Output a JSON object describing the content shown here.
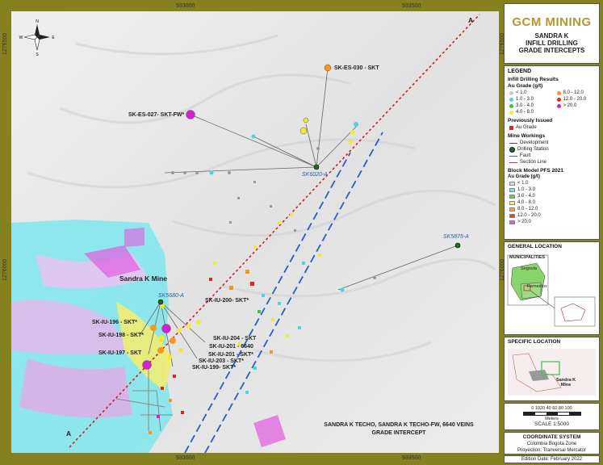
{
  "map": {
    "coords_top": [
      "933000",
      "933500"
    ],
    "coords_bottom": [
      "933000",
      "933500"
    ],
    "coords_left": [
      "1276500",
      "1276000"
    ],
    "coords_right": [
      "1276500",
      "1276000"
    ],
    "section_letters": [
      "A",
      "A"
    ],
    "station_labels": [
      "SK6020-A",
      "SK5875-A",
      "SK5680-A"
    ],
    "mine_label": "Sandra K Mine",
    "drill_labels": [
      "SK-ES-030 - SKT",
      "SK-ES-027- SKT-FW*",
      "SK-IU-200- SKT*",
      "SK-IU-196 - SKT*",
      "SK-IU-198 - SKT*",
      "SK-IU-204 - SKT",
      "SK-IU-201 - 6640",
      "SK-IU-201 - SKT*",
      "SK-IU-197 - SKT",
      "SK-IU-203 - SKT*",
      "SK-IU-199- SKT*"
    ],
    "caption_lines": [
      "SANDRA K TECHO, SANDRA K TECHO-FW, 6640  VEINS",
      "GRADE INTERCEPT"
    ]
  },
  "sidebar": {
    "logo_text": "GCM MINING",
    "title_lines": [
      "SANDRA K",
      "INFILL DRILLING",
      "GRADE INTERCEPTS"
    ],
    "legend": {
      "heading": "LEGEND",
      "infill_heading": "Infill Drilling Results",
      "au_grade_label": "Au Grade (g/t)",
      "infill_classes": [
        {
          "label": "< 1.0",
          "color": "#c9c9c9"
        },
        {
          "label": "8.0 - 12.0",
          "color": "#f39a1e"
        },
        {
          "label": "1.0 - 3.0",
          "color": "#4fd3e0"
        },
        {
          "label": "12.0 - 20.0",
          "color": "#e3231d"
        },
        {
          "label": "3.0 - 4.0",
          "color": "#3cc44a"
        },
        {
          "label": "> 20.0",
          "color": "#d61fd1"
        },
        {
          "label": "4.0 - 8.0",
          "color": "#f2ea33"
        }
      ],
      "prev_heading": "Previously Issued",
      "prev_item": "Au Grade",
      "workings_heading": "Mine Workings",
      "workings_items": [
        "Development",
        "Drilling Station",
        "Fault",
        "Section Line"
      ],
      "block_heading": "Block Model PFS 2021",
      "block_au_label": "Au Grade (g/t)",
      "block_classes": [
        {
          "label": "< 1.0",
          "color": "#d8d8d8"
        },
        {
          "label": "1.0 - 3.0",
          "color": "#63e8ef"
        },
        {
          "label": "3.0 - 4.0",
          "color": "#58d357"
        },
        {
          "label": "4.0 - 8.0",
          "color": "#f2ee6a"
        },
        {
          "label": "8.0 - 12.0",
          "color": "#f0a33a"
        },
        {
          "label": "12.0 - 20.0",
          "color": "#e43b2c"
        },
        {
          "label": "> 20.0",
          "color": "#e25ae0"
        }
      ]
    },
    "general_location": {
      "heading": "GENERAL LOCATION",
      "municipalities": "MUNICIPALITIES",
      "places": [
        "Segovia",
        "Remedios"
      ]
    },
    "specific_location": {
      "heading": "SPECIFIC LOCATION",
      "mine_label_lines": [
        "Sandra K",
        "Mine"
      ]
    },
    "scale": {
      "ticks": "0 1020   40   60   80   100",
      "unit": "Meters",
      "ratio": "SCALE  1:5000"
    },
    "coordinate_system": {
      "heading": "COORDINATE SYSTEM",
      "zone": "Colombia Bogota Zone",
      "projection": "Proyection: Tranversal Mercator"
    },
    "edition": "Edition Date: February 2022"
  }
}
